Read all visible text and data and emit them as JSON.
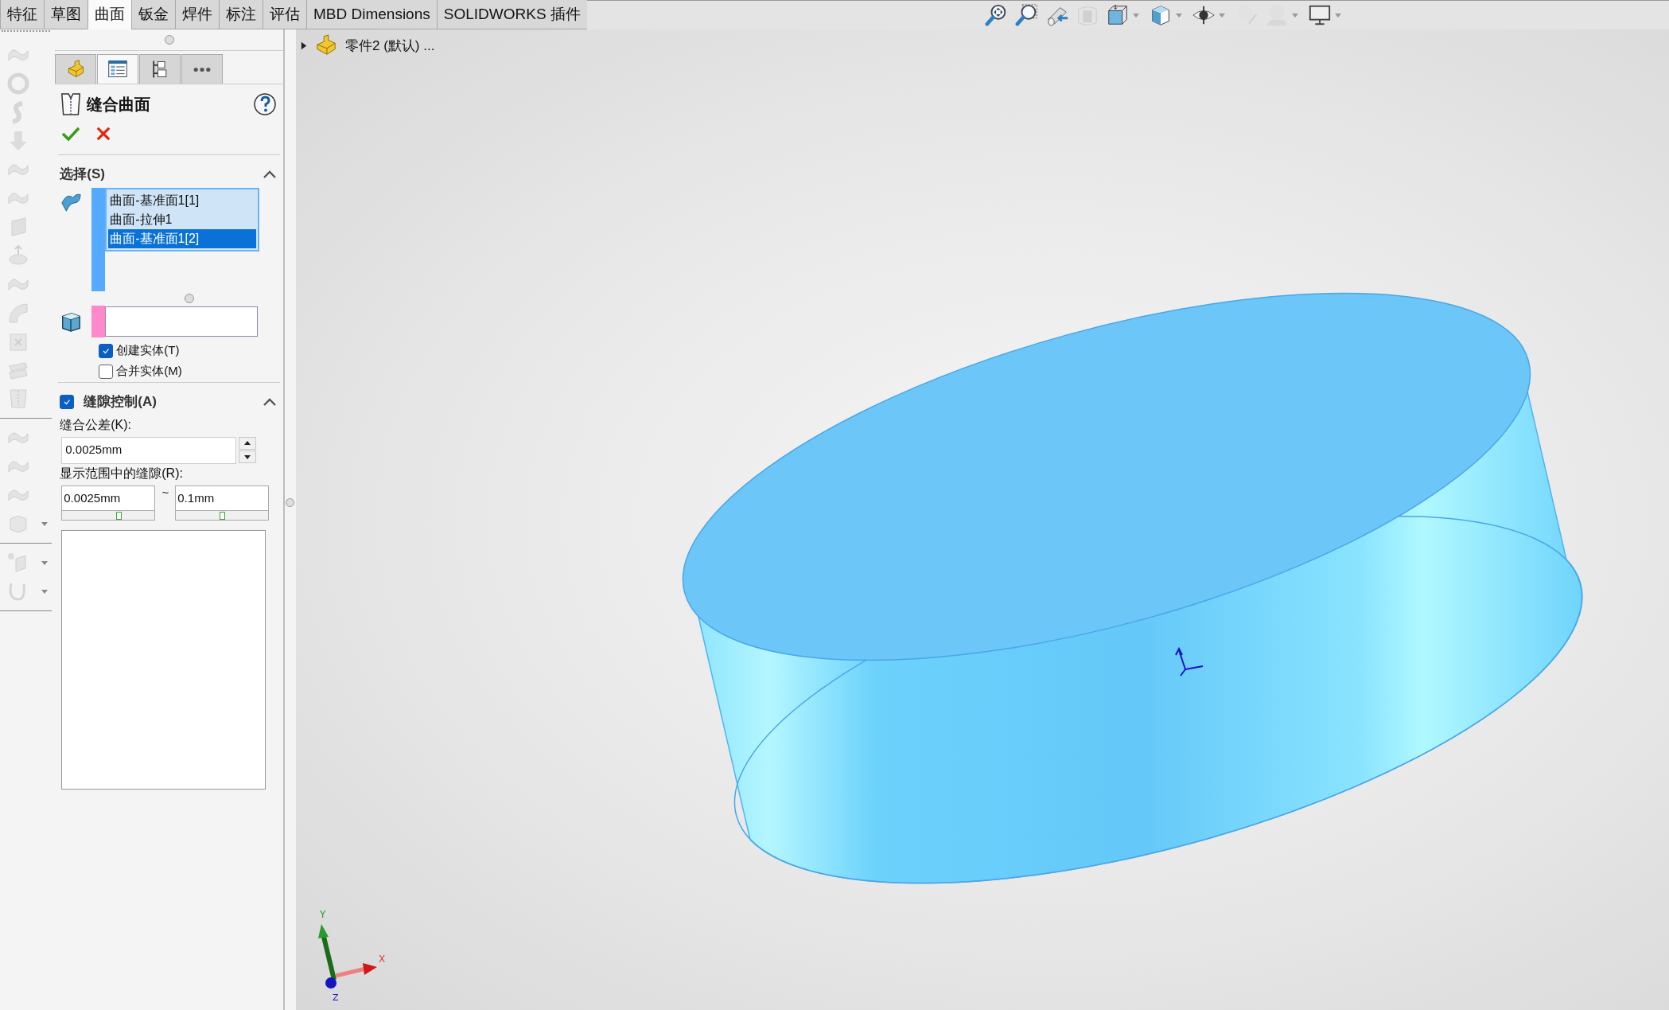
{
  "tabs": [
    {
      "label": "特征",
      "selected": false
    },
    {
      "label": "草图",
      "selected": false
    },
    {
      "label": "曲面",
      "selected": true
    },
    {
      "label": "钣金",
      "selected": false
    },
    {
      "label": "焊件",
      "selected": false
    },
    {
      "label": "标注",
      "selected": false
    },
    {
      "label": "评估",
      "selected": false
    },
    {
      "label": "MBD Dimensions",
      "selected": false
    },
    {
      "label": "SOLIDWORKS 插件",
      "selected": false
    }
  ],
  "panel_tabs": [
    {
      "kind": "feature-tree",
      "selected": false
    },
    {
      "kind": "property-manager",
      "selected": true
    },
    {
      "kind": "configuration-manager",
      "selected": false
    },
    {
      "kind": "more",
      "selected": false
    }
  ],
  "property_manager": {
    "title": "缝合曲面"
  },
  "selection": {
    "title": "选择(S)",
    "expanded": true,
    "items": [
      {
        "label": "曲面-基准面1[1]",
        "selected": false
      },
      {
        "label": "曲面-拉伸1",
        "selected": false
      },
      {
        "label": "曲面-基准面1[2]",
        "selected": true
      }
    ]
  },
  "options": [
    {
      "label": "创建实体(T)",
      "checked": true
    },
    {
      "label": "合并实体(M)",
      "checked": false
    }
  ],
  "gap_control": {
    "title": "缝隙控制(A)",
    "checked": true,
    "expanded": true,
    "tolerance_label": "缝合公差(K):",
    "tolerance": "0.0025mm",
    "range_label": "显示范围中的缝隙(R):",
    "range_min": {
      "value": "0.0025mm",
      "level": 0.61
    },
    "range_separator": "~",
    "range_max": {
      "value": "0.1mm",
      "level": 0.5
    }
  },
  "feature_tree": {
    "root": "零件2 (默认) ...",
    "expanded": false
  },
  "triad": {
    "x": "X",
    "y": "Y",
    "z": "Z"
  }
}
